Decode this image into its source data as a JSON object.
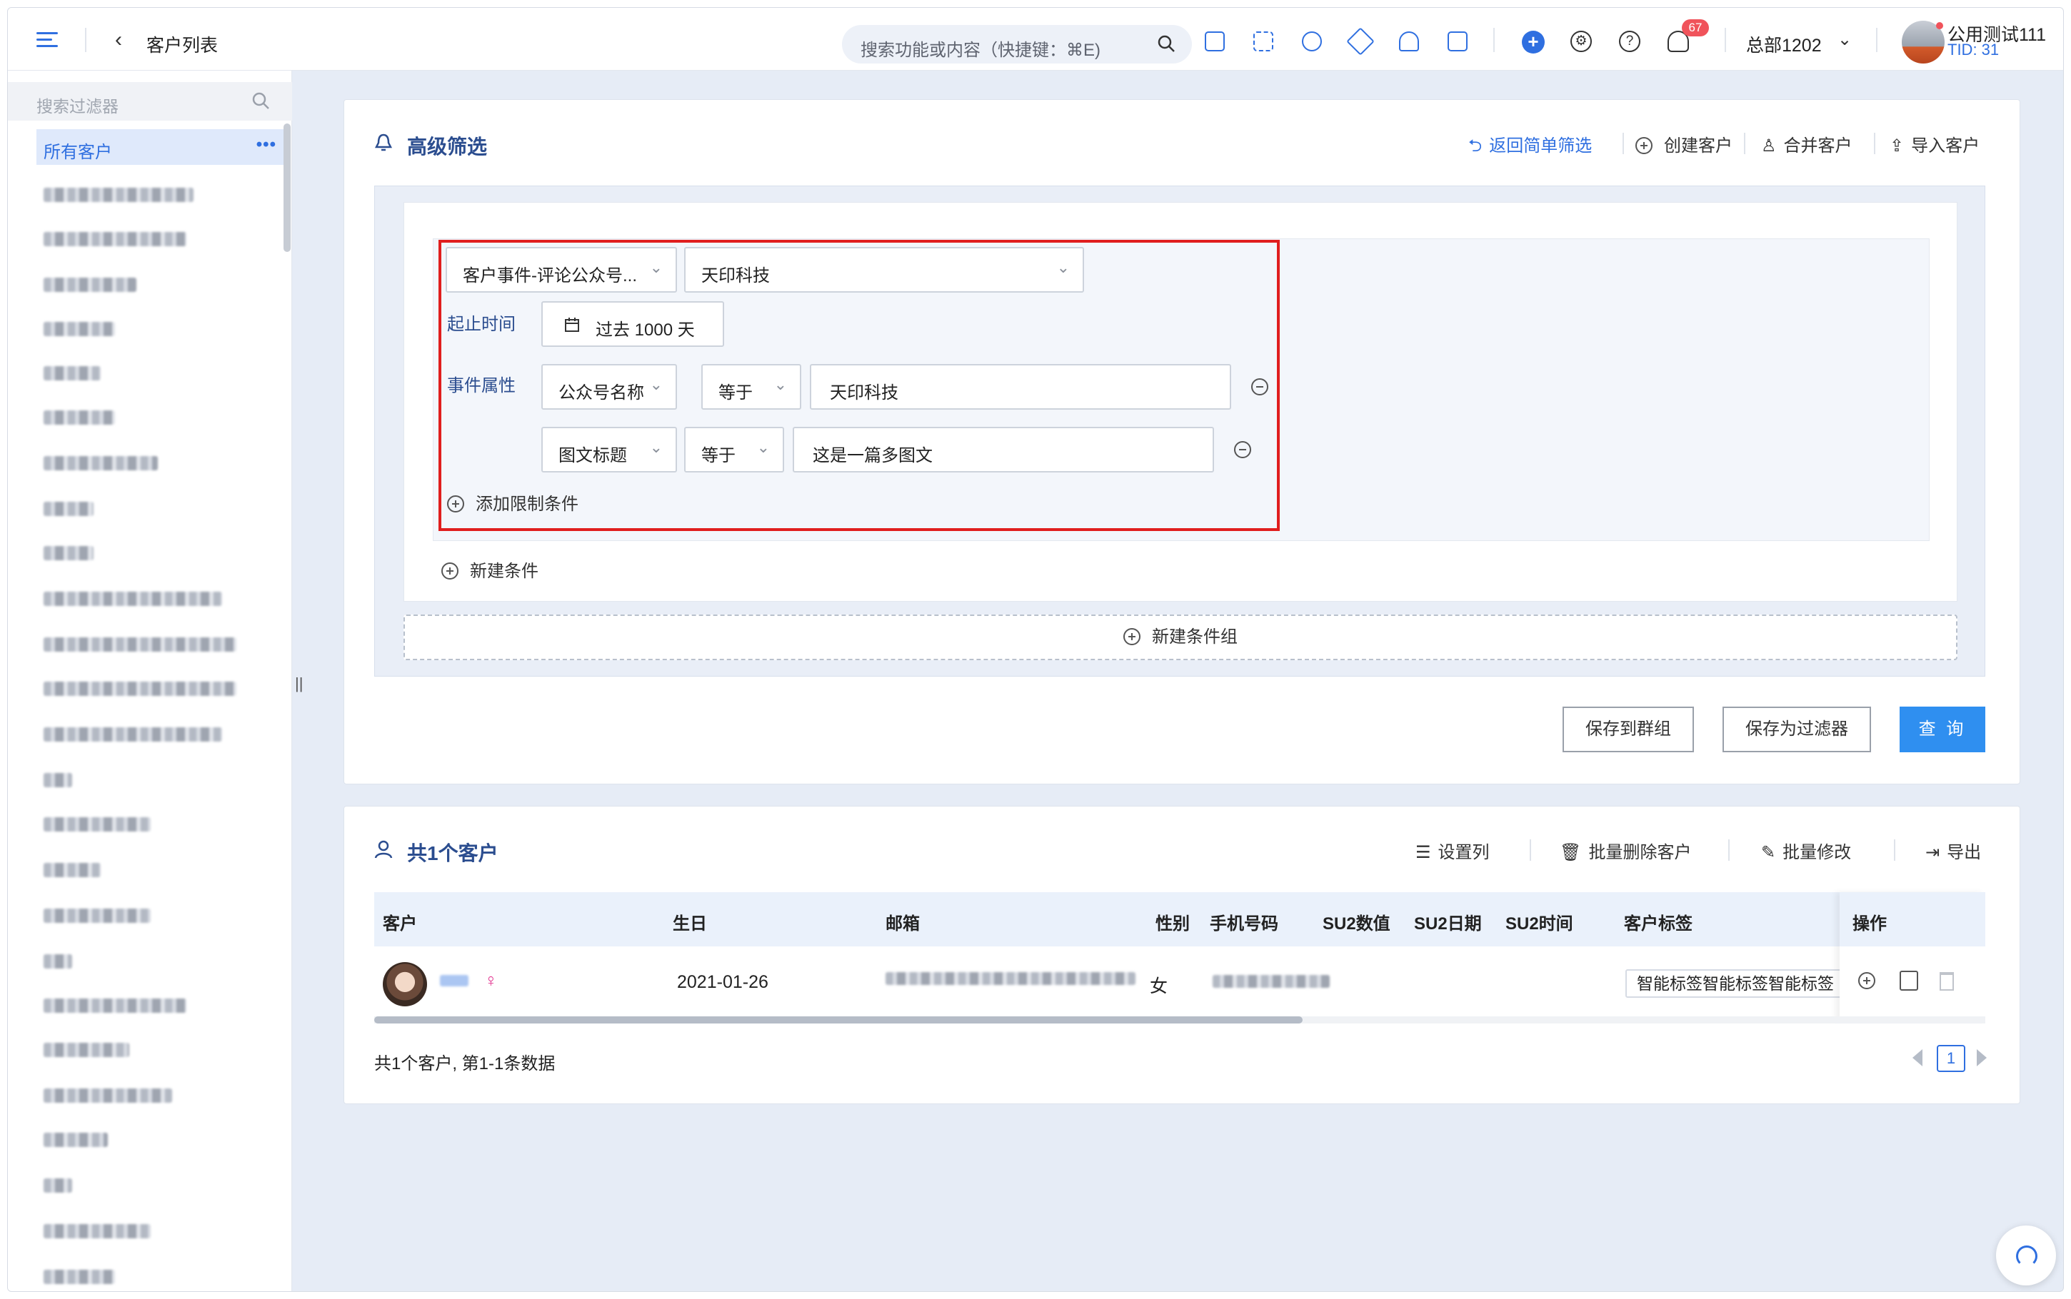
{
  "topbar": {
    "page_title": "客户列表",
    "search_placeholder": "搜索功能或内容（快捷键：⌘E)",
    "notification_count": "67",
    "org_name": "总部1202",
    "user_name": "公用测试111",
    "tenant_id": "TID: 31",
    "accent_color": "#2f6fe0"
  },
  "sidebar": {
    "search_placeholder": "搜索过滤器",
    "active_item": "所有客户",
    "more_label": "•••"
  },
  "filter_card": {
    "title": "高级筛选",
    "actions": {
      "back_simple": "返回简单筛选",
      "create": "创建客户",
      "merge": "合并客户",
      "import": "导入客户"
    },
    "condition": {
      "event_select": "客户事件-评论公众号...",
      "account_select": "天印科技",
      "time_label": "起止时间",
      "time_value": "过去 1000 天",
      "attr_label": "事件属性",
      "attributes": [
        {
          "field": "公众号名称",
          "op": "等于",
          "value": "天印科技"
        },
        {
          "field": "图文标题",
          "op": "等于",
          "value": "这是一篇多图文"
        }
      ],
      "add_limit": "添加限制条件"
    },
    "new_condition": "新建条件",
    "new_group": "新建条件组",
    "buttons": {
      "save_group": "保存到群组",
      "save_filter": "保存为过滤器",
      "query": "查 询"
    }
  },
  "result_card": {
    "title": "共1个客户",
    "actions": {
      "columns": "设置列",
      "batch_delete": "批量删除客户",
      "batch_edit": "批量修改",
      "export": "导出"
    },
    "columns": [
      "客户",
      "生日",
      "邮箱",
      "性别",
      "手机号码",
      "SU2数值",
      "SU2日期",
      "SU2时间",
      "客户标签",
      "操作"
    ],
    "rows": [
      {
        "gender_icon": "♀",
        "birthday": "2021-01-26",
        "gender": "女",
        "tags": "智能标签智能标签智能标签"
      }
    ],
    "footer": "共1个客户, 第1-1条数据",
    "page": "1"
  }
}
